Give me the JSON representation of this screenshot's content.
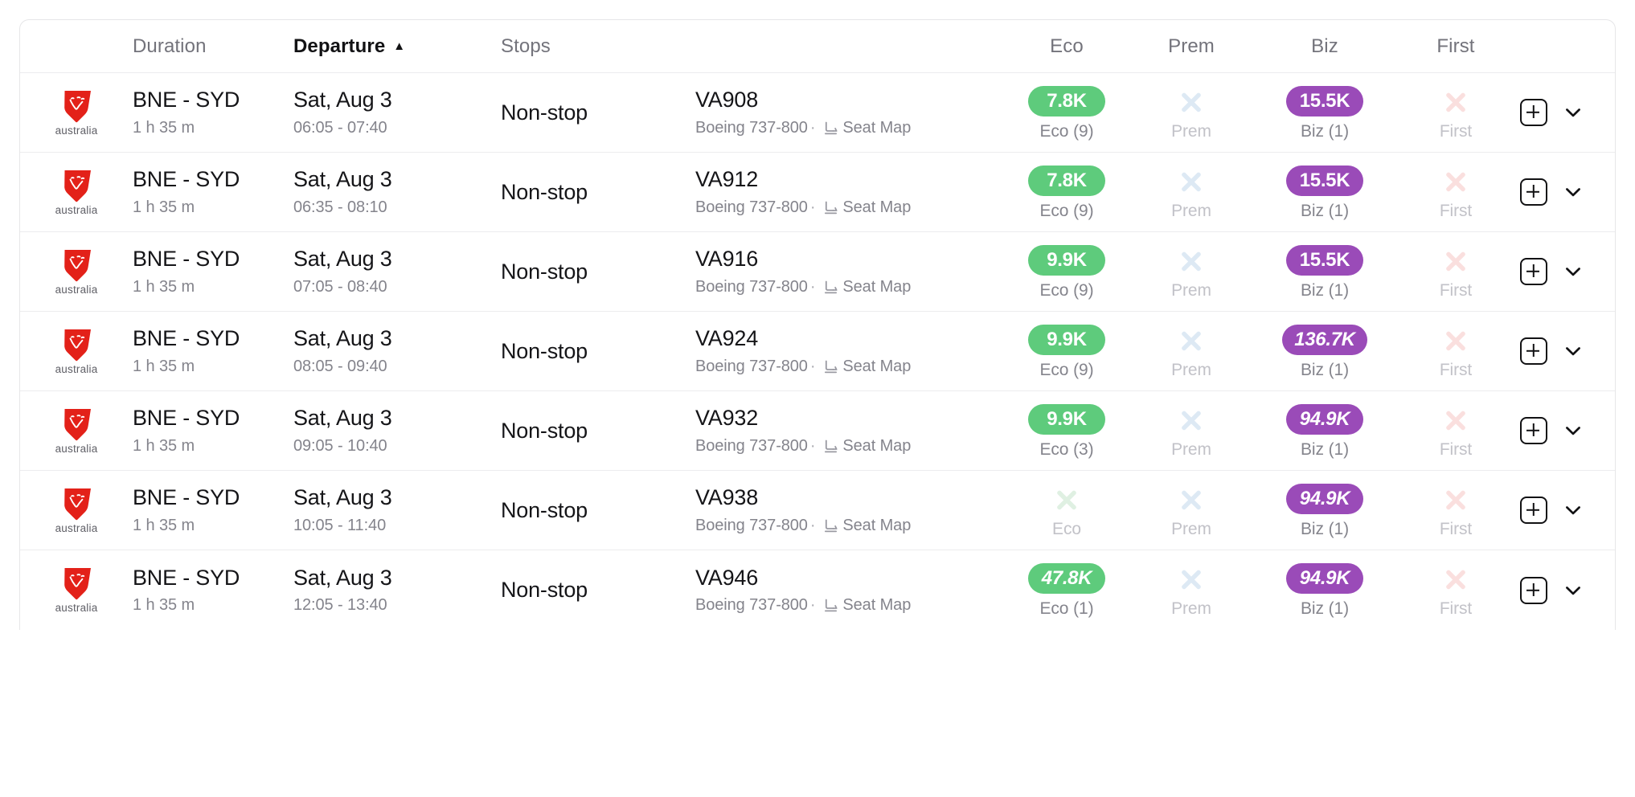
{
  "table": {
    "columns": [
      {
        "key": "airline",
        "label": "",
        "align": "center",
        "sorted": false
      },
      {
        "key": "duration",
        "label": "Duration",
        "align": "left",
        "sorted": false
      },
      {
        "key": "departure",
        "label": "Departure",
        "align": "left",
        "sorted": true,
        "sort_direction": "asc",
        "sort_caret": "▲"
      },
      {
        "key": "stops",
        "label": "Stops",
        "align": "left",
        "sorted": false
      },
      {
        "key": "flight",
        "label": "",
        "align": "left",
        "sorted": false
      },
      {
        "key": "eco",
        "label": "Eco",
        "align": "center",
        "sorted": false
      },
      {
        "key": "prem",
        "label": "Prem",
        "align": "center",
        "sorted": false
      },
      {
        "key": "biz",
        "label": "Biz",
        "align": "center",
        "sorted": false
      },
      {
        "key": "first",
        "label": "First",
        "align": "center",
        "sorted": false
      },
      {
        "key": "actions",
        "label": "",
        "align": "center",
        "sorted": false
      }
    ],
    "airline": {
      "name": "Virgin Australia",
      "wordmark": "Virgin",
      "subtext": "australia",
      "logo_color": "#E32119"
    },
    "icons": {
      "seat_map": "airline-seat-icon",
      "add": "plus-square-icon",
      "expand": "chevron-down-icon",
      "unavailable": "x-icon",
      "sort_asc": "caret-up-icon"
    },
    "colors": {
      "eco_pill": "#5ECB7C",
      "biz_pill": "#9A4BB8",
      "eco_x": "#DFF0E2",
      "prem_x": "#DDE9F4",
      "biz_x": "#EADCF0",
      "first_x": "#FADFDE",
      "row_border": "#ECECEE",
      "header_text": "#73737B",
      "primary_text": "#151518",
      "secondary_text": "#84848C"
    },
    "labels": {
      "seat_map": "Seat Map",
      "separator": "·",
      "eco": "Eco",
      "prem": "Prem",
      "biz": "Biz",
      "first": "First"
    },
    "rows": [
      {
        "route": "BNE - SYD",
        "duration": "1 h 35 m",
        "date": "Sat, Aug 3",
        "times": "06:05 - 07:40",
        "stops": "Non-stop",
        "flight_number": "VA908",
        "aircraft": "Boeing 737-800",
        "seat_map": "Seat Map",
        "fares": {
          "eco": {
            "available": true,
            "price": "7.8K",
            "label": "Eco (9)",
            "italic": false
          },
          "prem": {
            "available": false,
            "price": "",
            "label": "Prem",
            "italic": false
          },
          "biz": {
            "available": true,
            "price": "15.5K",
            "label": "Biz (1)",
            "italic": false
          },
          "first": {
            "available": false,
            "price": "",
            "label": "First",
            "italic": false
          }
        }
      },
      {
        "route": "BNE - SYD",
        "duration": "1 h 35 m",
        "date": "Sat, Aug 3",
        "times": "06:35 - 08:10",
        "stops": "Non-stop",
        "flight_number": "VA912",
        "aircraft": "Boeing 737-800",
        "seat_map": "Seat Map",
        "fares": {
          "eco": {
            "available": true,
            "price": "7.8K",
            "label": "Eco (9)",
            "italic": false
          },
          "prem": {
            "available": false,
            "price": "",
            "label": "Prem",
            "italic": false
          },
          "biz": {
            "available": true,
            "price": "15.5K",
            "label": "Biz (1)",
            "italic": false
          },
          "first": {
            "available": false,
            "price": "",
            "label": "First",
            "italic": false
          }
        }
      },
      {
        "route": "BNE - SYD",
        "duration": "1 h 35 m",
        "date": "Sat, Aug 3",
        "times": "07:05 - 08:40",
        "stops": "Non-stop",
        "flight_number": "VA916",
        "aircraft": "Boeing 737-800",
        "seat_map": "Seat Map",
        "fares": {
          "eco": {
            "available": true,
            "price": "9.9K",
            "label": "Eco (9)",
            "italic": false
          },
          "prem": {
            "available": false,
            "price": "",
            "label": "Prem",
            "italic": false
          },
          "biz": {
            "available": true,
            "price": "15.5K",
            "label": "Biz (1)",
            "italic": false
          },
          "first": {
            "available": false,
            "price": "",
            "label": "First",
            "italic": false
          }
        }
      },
      {
        "route": "BNE - SYD",
        "duration": "1 h 35 m",
        "date": "Sat, Aug 3",
        "times": "08:05 - 09:40",
        "stops": "Non-stop",
        "flight_number": "VA924",
        "aircraft": "Boeing 737-800",
        "seat_map": "Seat Map",
        "fares": {
          "eco": {
            "available": true,
            "price": "9.9K",
            "label": "Eco (9)",
            "italic": false
          },
          "prem": {
            "available": false,
            "price": "",
            "label": "Prem",
            "italic": false
          },
          "biz": {
            "available": true,
            "price": "136.7K",
            "label": "Biz (1)",
            "italic": true
          },
          "first": {
            "available": false,
            "price": "",
            "label": "First",
            "italic": false
          }
        }
      },
      {
        "route": "BNE - SYD",
        "duration": "1 h 35 m",
        "date": "Sat, Aug 3",
        "times": "09:05 - 10:40",
        "stops": "Non-stop",
        "flight_number": "VA932",
        "aircraft": "Boeing 737-800",
        "seat_map": "Seat Map",
        "fares": {
          "eco": {
            "available": true,
            "price": "9.9K",
            "label": "Eco (3)",
            "italic": false
          },
          "prem": {
            "available": false,
            "price": "",
            "label": "Prem",
            "italic": false
          },
          "biz": {
            "available": true,
            "price": "94.9K",
            "label": "Biz (1)",
            "italic": true
          },
          "first": {
            "available": false,
            "price": "",
            "label": "First",
            "italic": false
          }
        }
      },
      {
        "route": "BNE - SYD",
        "duration": "1 h 35 m",
        "date": "Sat, Aug 3",
        "times": "10:05 - 11:40",
        "stops": "Non-stop",
        "flight_number": "VA938",
        "aircraft": "Boeing 737-800",
        "seat_map": "Seat Map",
        "fares": {
          "eco": {
            "available": false,
            "price": "",
            "label": "Eco",
            "italic": false
          },
          "prem": {
            "available": false,
            "price": "",
            "label": "Prem",
            "italic": false
          },
          "biz": {
            "available": true,
            "price": "94.9K",
            "label": "Biz (1)",
            "italic": true
          },
          "first": {
            "available": false,
            "price": "",
            "label": "First",
            "italic": false
          }
        }
      },
      {
        "route": "BNE - SYD",
        "duration": "1 h 35 m",
        "date": "Sat, Aug 3",
        "times": "12:05 - 13:40",
        "stops": "Non-stop",
        "flight_number": "VA946",
        "aircraft": "Boeing 737-800",
        "seat_map": "Seat Map",
        "fares": {
          "eco": {
            "available": true,
            "price": "47.8K",
            "label": "Eco (1)",
            "italic": true
          },
          "prem": {
            "available": false,
            "price": "",
            "label": "Prem",
            "italic": false
          },
          "biz": {
            "available": true,
            "price": "94.9K",
            "label": "Biz (1)",
            "italic": true
          },
          "first": {
            "available": false,
            "price": "",
            "label": "First",
            "italic": false
          }
        }
      }
    ]
  }
}
